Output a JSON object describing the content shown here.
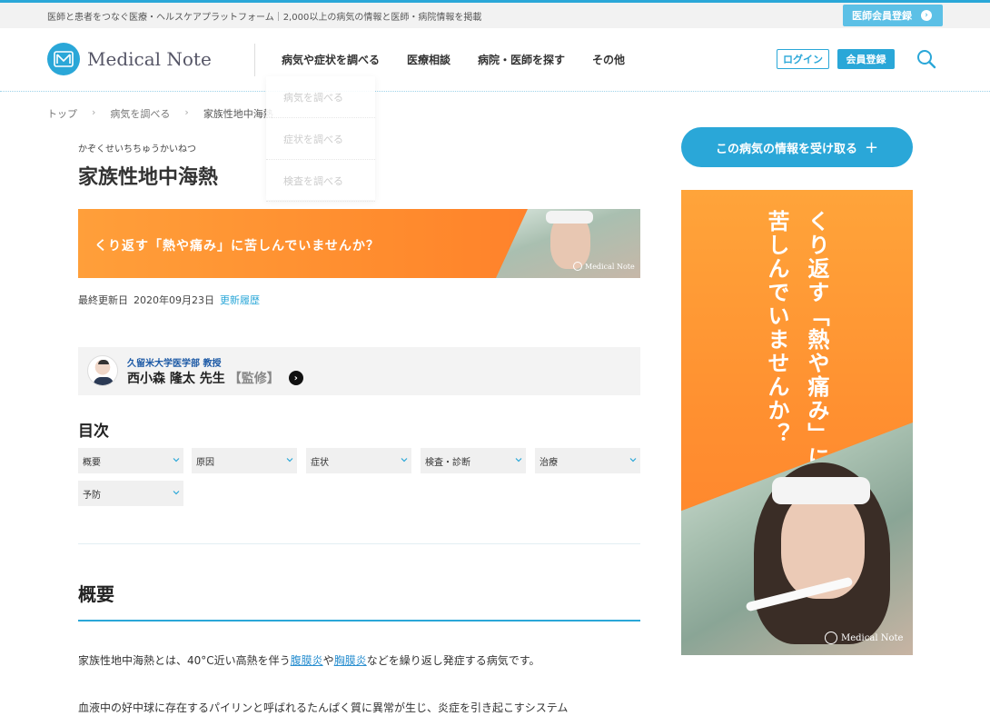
{
  "topbar": {
    "tagline": "医師と患者をつなぐ医療・ヘルスケアプラットフォーム｜2,000以上の病気の情報と医師・病院情報を掲載",
    "doctor_register": "医師会員登録"
  },
  "header": {
    "logo_text": "Medical Note",
    "nav": [
      "病気や症状を調べる",
      "医療相談",
      "病院・医師を探す",
      "その他"
    ],
    "login": "ログイン",
    "register": "会員登録"
  },
  "dropdown": [
    "病気を調べる",
    "症状を調べる",
    "検査を調べる"
  ],
  "breadcrumb": [
    "トップ",
    "病気を調べる",
    "家族性地中海熱"
  ],
  "article": {
    "kana": "かぞくせいちちゅうかいねつ",
    "title": "家族性地中海熱",
    "banner_text": "くり返す「熱や痛み」に苦しんでいませんか？",
    "banner_brand": "Medical Note",
    "updated_label": "最終更新日",
    "updated_date": "2020年09月23日",
    "history_link": "更新履歴",
    "supervisor": {
      "affiliation": "久留米大学医学部 教授",
      "name": "西小森 隆太 先生",
      "role": "【監修】"
    },
    "toc_title": "目次",
    "toc": [
      "概要",
      "原因",
      "症状",
      "検査・診断",
      "治療",
      "予防"
    ],
    "section_title": "概要",
    "para1_before": "家族性地中海熱とは、40°C近い高熱を伴う",
    "para1_link1": "腹膜炎",
    "para1_mid": "や",
    "para1_link2": "胸膜炎",
    "para1_after": "などを繰り返し発症する病気です。",
    "para2": "血液中の好中球に存在するパイリンと呼ばれるたんぱく質に異常が生じ、炎症を引き起こすシステム"
  },
  "sidebar": {
    "cta": "この病気の情報を受け取る",
    "ad_line1": "くり返す「熱や痛み」に",
    "ad_line2": "苦しんでいませんか？",
    "ad_brand": "Medical Note"
  },
  "colors": {
    "accent": "#2aa7d8",
    "banner": "#ff8f30"
  }
}
